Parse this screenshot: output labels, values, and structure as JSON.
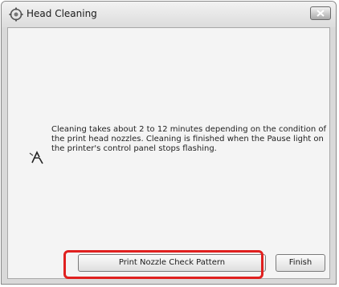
{
  "window": {
    "title": "Head Cleaning"
  },
  "message": {
    "line1": "Cleaning takes about 2 to 12 minutes depending on the condition of",
    "line2": "the print head nozzles. Cleaning is finished when the Pause light on",
    "line3": "the printer's control panel stops flashing."
  },
  "buttons": {
    "print_nozzle_check": "Print Nozzle Check Pattern",
    "finish": "Finish"
  },
  "icons": {
    "title": "printer-app-icon",
    "close": "close-icon",
    "message": "print-head-icon"
  },
  "colors": {
    "highlight": "#e0201f",
    "window_frame": "#d9d9d9",
    "client_bg": "#f4f4f4"
  }
}
